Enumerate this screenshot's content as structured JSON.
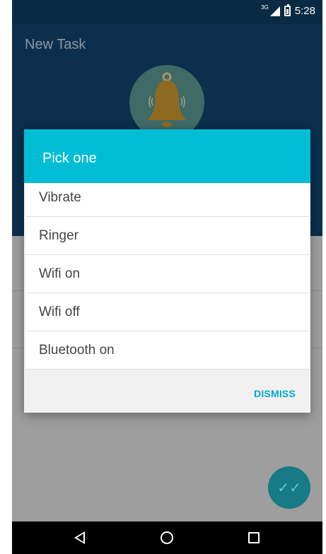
{
  "status_bar": {
    "network": "3G",
    "time": "5:28"
  },
  "app": {
    "title": "New Task"
  },
  "dialog": {
    "title": "Pick one",
    "options": [
      "Vibrate",
      "Ringer",
      "Wifi on",
      "Wifi off",
      "Bluetooth on"
    ],
    "dismiss_label": "DISMISS"
  },
  "icons": {
    "bell": "bell-icon",
    "fab": "double-check-icon",
    "nav_back": "back-icon",
    "nav_home": "home-icon",
    "nav_recent": "recent-apps-icon"
  },
  "colors": {
    "dialog_header": "#00bcd4",
    "dismiss": "#00a8c8",
    "app_header": "#0b2f4d"
  }
}
